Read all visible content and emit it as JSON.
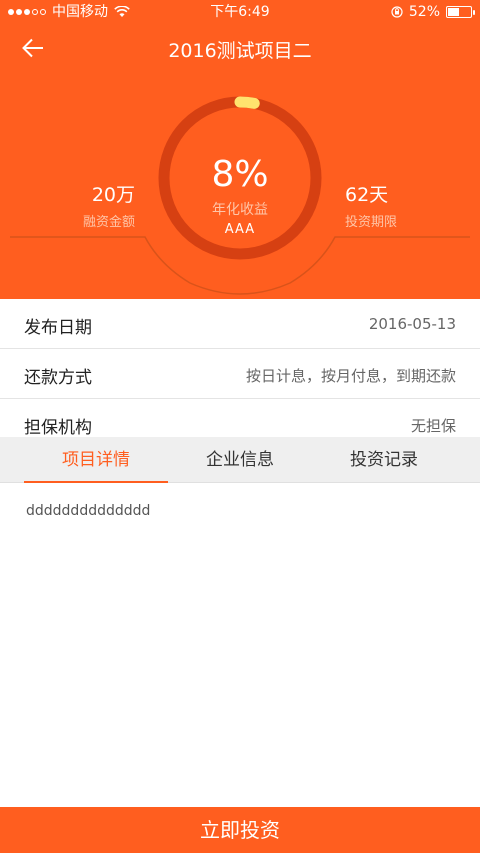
{
  "status_bar": {
    "carrier": "中国移动",
    "time": "下午6:49",
    "battery": "52%",
    "battery_level": 0.52,
    "signal_dots_filled": 3,
    "signal_dots_total": 5
  },
  "nav": {
    "title": "2016测试项目二"
  },
  "hero": {
    "rate": "8%",
    "rate_label": "年化收益",
    "grade": "AAA",
    "progress": 0.03,
    "amount_value": "20万",
    "amount_label": "融资金额",
    "term_value": "62天",
    "term_label": "投资期限"
  },
  "info": {
    "rows": [
      {
        "key": "发布日期",
        "value": "2016-05-13"
      },
      {
        "key": "还款方式",
        "value": "按日计息，按月付息，到期还款"
      },
      {
        "key": "担保机构",
        "value": "无担保"
      }
    ]
  },
  "tabs": {
    "items": [
      {
        "label": "项目详情"
      },
      {
        "label": "企业信息"
      },
      {
        "label": "投资记录"
      }
    ],
    "active_index": 0
  },
  "content": {
    "text": "dddddddddddddd"
  },
  "footer": {
    "invest_label": "立即投资"
  },
  "colors": {
    "accent": "#ff5e1f",
    "ring_track": "#d64012",
    "ring_progress": "#ffe36e"
  }
}
